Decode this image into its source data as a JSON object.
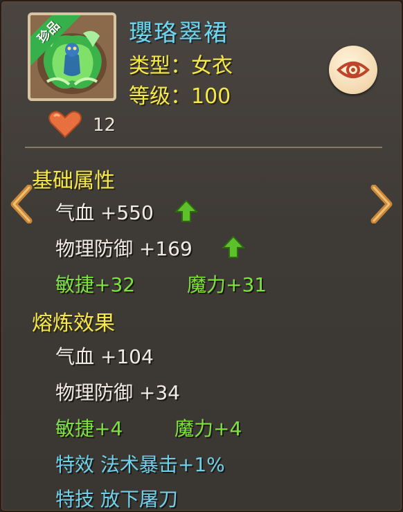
{
  "item": {
    "rarity_badge": "珍品",
    "name": "瓔珞翠裙",
    "type_line": "类型：女衣",
    "level_line": "等级：100",
    "likes": "12"
  },
  "base_section": {
    "title": "基础属性",
    "hp": "气血  +550",
    "phys_def": "物理防御  +169",
    "agility": "敏捷+32",
    "magic": "魔力+31"
  },
  "refine_section": {
    "title": "熔炼效果",
    "hp": "气血  +104",
    "phys_def": "物理防御  +34",
    "agility": "敏捷+4",
    "magic": "魔力+4",
    "special_effect": "特效  法术暴击+1%",
    "special_skill": "特技  放下屠刀"
  },
  "colors": {
    "yellow": "#f4e84a",
    "cyan": "#6fd6ee",
    "green": "#7ee23c",
    "white": "#f0ece4",
    "heart": "#e8703e"
  },
  "icons": [
    "eye-icon",
    "heart-icon",
    "up-arrow-icon",
    "left-arrow-icon",
    "right-arrow-icon"
  ]
}
